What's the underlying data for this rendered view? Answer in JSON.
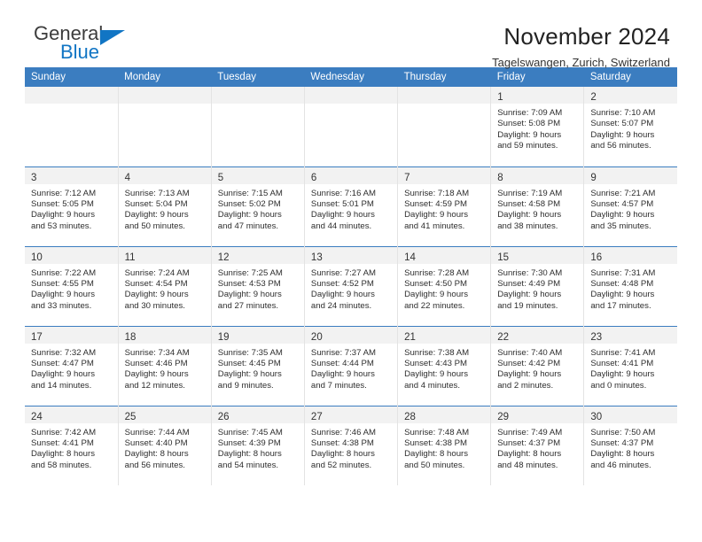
{
  "brand": {
    "name_top": "General",
    "name_bottom": "Blue",
    "triangle_color": "#1175c4",
    "text_color": "#3c3c3c"
  },
  "header": {
    "title": "November 2024",
    "subtitle": "Tagelswangen, Zurich, Switzerland"
  },
  "colors": {
    "header_row_bg": "#3b7dc0",
    "header_row_text": "#ffffff",
    "daynum_band_bg": "#f2f2f2",
    "cell_border": "#e3e3e3",
    "week_rule": "#3b7dc0"
  },
  "weekdays": [
    "Sunday",
    "Monday",
    "Tuesday",
    "Wednesday",
    "Thursday",
    "Friday",
    "Saturday"
  ],
  "labels": {
    "sunrise_prefix": "Sunrise:",
    "sunset_prefix": "Sunset:",
    "daylight_prefix": "Daylight:"
  },
  "weeks": [
    [
      {
        "empty": true
      },
      {
        "empty": true
      },
      {
        "empty": true
      },
      {
        "empty": true
      },
      {
        "empty": true
      },
      {
        "day": "1",
        "sunrise": "Sunrise: 7:09 AM",
        "sunset": "Sunset: 5:08 PM",
        "daylight1": "Daylight: 9 hours",
        "daylight2": "and 59 minutes."
      },
      {
        "day": "2",
        "sunrise": "Sunrise: 7:10 AM",
        "sunset": "Sunset: 5:07 PM",
        "daylight1": "Daylight: 9 hours",
        "daylight2": "and 56 minutes."
      }
    ],
    [
      {
        "day": "3",
        "sunrise": "Sunrise: 7:12 AM",
        "sunset": "Sunset: 5:05 PM",
        "daylight1": "Daylight: 9 hours",
        "daylight2": "and 53 minutes."
      },
      {
        "day": "4",
        "sunrise": "Sunrise: 7:13 AM",
        "sunset": "Sunset: 5:04 PM",
        "daylight1": "Daylight: 9 hours",
        "daylight2": "and 50 minutes."
      },
      {
        "day": "5",
        "sunrise": "Sunrise: 7:15 AM",
        "sunset": "Sunset: 5:02 PM",
        "daylight1": "Daylight: 9 hours",
        "daylight2": "and 47 minutes."
      },
      {
        "day": "6",
        "sunrise": "Sunrise: 7:16 AM",
        "sunset": "Sunset: 5:01 PM",
        "daylight1": "Daylight: 9 hours",
        "daylight2": "and 44 minutes."
      },
      {
        "day": "7",
        "sunrise": "Sunrise: 7:18 AM",
        "sunset": "Sunset: 4:59 PM",
        "daylight1": "Daylight: 9 hours",
        "daylight2": "and 41 minutes."
      },
      {
        "day": "8",
        "sunrise": "Sunrise: 7:19 AM",
        "sunset": "Sunset: 4:58 PM",
        "daylight1": "Daylight: 9 hours",
        "daylight2": "and 38 minutes."
      },
      {
        "day": "9",
        "sunrise": "Sunrise: 7:21 AM",
        "sunset": "Sunset: 4:57 PM",
        "daylight1": "Daylight: 9 hours",
        "daylight2": "and 35 minutes."
      }
    ],
    [
      {
        "day": "10",
        "sunrise": "Sunrise: 7:22 AM",
        "sunset": "Sunset: 4:55 PM",
        "daylight1": "Daylight: 9 hours",
        "daylight2": "and 33 minutes."
      },
      {
        "day": "11",
        "sunrise": "Sunrise: 7:24 AM",
        "sunset": "Sunset: 4:54 PM",
        "daylight1": "Daylight: 9 hours",
        "daylight2": "and 30 minutes."
      },
      {
        "day": "12",
        "sunrise": "Sunrise: 7:25 AM",
        "sunset": "Sunset: 4:53 PM",
        "daylight1": "Daylight: 9 hours",
        "daylight2": "and 27 minutes."
      },
      {
        "day": "13",
        "sunrise": "Sunrise: 7:27 AM",
        "sunset": "Sunset: 4:52 PM",
        "daylight1": "Daylight: 9 hours",
        "daylight2": "and 24 minutes."
      },
      {
        "day": "14",
        "sunrise": "Sunrise: 7:28 AM",
        "sunset": "Sunset: 4:50 PM",
        "daylight1": "Daylight: 9 hours",
        "daylight2": "and 22 minutes."
      },
      {
        "day": "15",
        "sunrise": "Sunrise: 7:30 AM",
        "sunset": "Sunset: 4:49 PM",
        "daylight1": "Daylight: 9 hours",
        "daylight2": "and 19 minutes."
      },
      {
        "day": "16",
        "sunrise": "Sunrise: 7:31 AM",
        "sunset": "Sunset: 4:48 PM",
        "daylight1": "Daylight: 9 hours",
        "daylight2": "and 17 minutes."
      }
    ],
    [
      {
        "day": "17",
        "sunrise": "Sunrise: 7:32 AM",
        "sunset": "Sunset: 4:47 PM",
        "daylight1": "Daylight: 9 hours",
        "daylight2": "and 14 minutes."
      },
      {
        "day": "18",
        "sunrise": "Sunrise: 7:34 AM",
        "sunset": "Sunset: 4:46 PM",
        "daylight1": "Daylight: 9 hours",
        "daylight2": "and 12 minutes."
      },
      {
        "day": "19",
        "sunrise": "Sunrise: 7:35 AM",
        "sunset": "Sunset: 4:45 PM",
        "daylight1": "Daylight: 9 hours",
        "daylight2": "and 9 minutes."
      },
      {
        "day": "20",
        "sunrise": "Sunrise: 7:37 AM",
        "sunset": "Sunset: 4:44 PM",
        "daylight1": "Daylight: 9 hours",
        "daylight2": "and 7 minutes."
      },
      {
        "day": "21",
        "sunrise": "Sunrise: 7:38 AM",
        "sunset": "Sunset: 4:43 PM",
        "daylight1": "Daylight: 9 hours",
        "daylight2": "and 4 minutes."
      },
      {
        "day": "22",
        "sunrise": "Sunrise: 7:40 AM",
        "sunset": "Sunset: 4:42 PM",
        "daylight1": "Daylight: 9 hours",
        "daylight2": "and 2 minutes."
      },
      {
        "day": "23",
        "sunrise": "Sunrise: 7:41 AM",
        "sunset": "Sunset: 4:41 PM",
        "daylight1": "Daylight: 9 hours",
        "daylight2": "and 0 minutes."
      }
    ],
    [
      {
        "day": "24",
        "sunrise": "Sunrise: 7:42 AM",
        "sunset": "Sunset: 4:41 PM",
        "daylight1": "Daylight: 8 hours",
        "daylight2": "and 58 minutes."
      },
      {
        "day": "25",
        "sunrise": "Sunrise: 7:44 AM",
        "sunset": "Sunset: 4:40 PM",
        "daylight1": "Daylight: 8 hours",
        "daylight2": "and 56 minutes."
      },
      {
        "day": "26",
        "sunrise": "Sunrise: 7:45 AM",
        "sunset": "Sunset: 4:39 PM",
        "daylight1": "Daylight: 8 hours",
        "daylight2": "and 54 minutes."
      },
      {
        "day": "27",
        "sunrise": "Sunrise: 7:46 AM",
        "sunset": "Sunset: 4:38 PM",
        "daylight1": "Daylight: 8 hours",
        "daylight2": "and 52 minutes."
      },
      {
        "day": "28",
        "sunrise": "Sunrise: 7:48 AM",
        "sunset": "Sunset: 4:38 PM",
        "daylight1": "Daylight: 8 hours",
        "daylight2": "and 50 minutes."
      },
      {
        "day": "29",
        "sunrise": "Sunrise: 7:49 AM",
        "sunset": "Sunset: 4:37 PM",
        "daylight1": "Daylight: 8 hours",
        "daylight2": "and 48 minutes."
      },
      {
        "day": "30",
        "sunrise": "Sunrise: 7:50 AM",
        "sunset": "Sunset: 4:37 PM",
        "daylight1": "Daylight: 8 hours",
        "daylight2": "and 46 minutes."
      }
    ]
  ]
}
